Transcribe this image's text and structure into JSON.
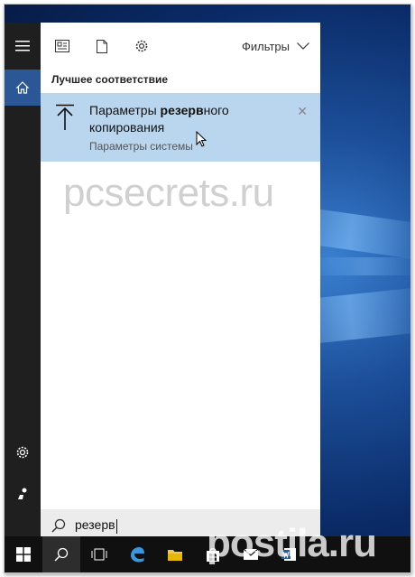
{
  "start_menu": {
    "topbar": {
      "icons": [
        "documents-icon",
        "file-icon",
        "settings-icon"
      ],
      "filters_label": "Фильтры"
    },
    "section_title": "Лучшее соответствие",
    "best_match": {
      "title_prefix": "Параметры ",
      "title_highlight": "резерв",
      "title_suffix": "ного копирования",
      "subtitle": "Параметры системы"
    },
    "search": {
      "value": "резерв"
    },
    "rail": [
      "hamburger-icon",
      "home-icon",
      "settings-icon",
      "user-icon"
    ]
  },
  "watermarks": {
    "site": "pcsecrets.ru",
    "postila": "postila.ru"
  },
  "taskbar": {
    "items": [
      "windows-start",
      "search",
      "task-view",
      "edge",
      "file-explorer",
      "store",
      "mail",
      "word"
    ]
  },
  "colors": {
    "highlight": "#b9d6ee",
    "rail": "#1f1f1f",
    "home_active": "#2b5797",
    "taskbar": "#101010"
  }
}
